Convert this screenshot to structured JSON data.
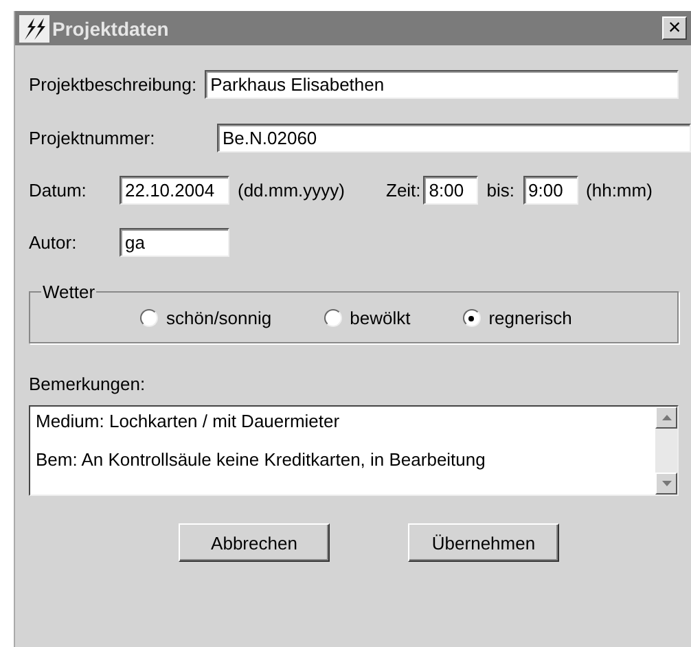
{
  "window": {
    "title": "Projektdaten",
    "close": "×"
  },
  "description": {
    "label": "Projektbeschreibung:",
    "value": "Parkhaus Elisabethen"
  },
  "number": {
    "label": "Projektnummer:",
    "value": "Be.N.02060"
  },
  "date": {
    "label": "Datum:",
    "value": "22.10.2004",
    "hint": "(dd.mm.yyyy)"
  },
  "time": {
    "label": "Zeit:",
    "from": "8:00",
    "to_label": "bis:",
    "to": "9:00",
    "hint": "(hh:mm)"
  },
  "author": {
    "label": "Autor:",
    "value": "ga"
  },
  "weather": {
    "label": "Wetter",
    "options": [
      {
        "label": "schön/sonnig",
        "selected": false
      },
      {
        "label": "bewölkt",
        "selected": false
      },
      {
        "label": "regnerisch",
        "selected": true
      }
    ]
  },
  "remarks": {
    "label": "Bemerkungen:",
    "lines": [
      "Medium: Lochkarten / mit Dauermieter",
      "Bem: An Kontrollsäule keine Kreditkarten, in Bearbeitung"
    ]
  },
  "buttons": [
    "Abbrechen",
    "Übernehmen"
  ]
}
